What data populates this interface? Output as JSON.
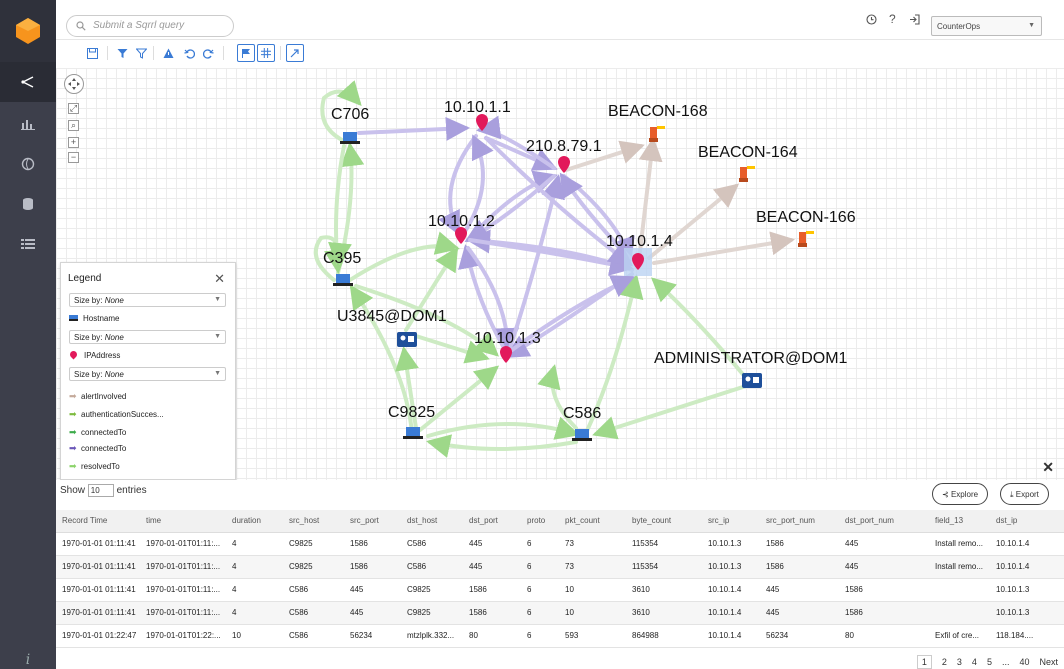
{
  "topbar": {
    "search_placeholder": "Submit a Sqrrl query",
    "help_label": "?",
    "workspace": "CounterOps"
  },
  "graph": {
    "nodes": [
      {
        "label": "C706",
        "type": "hostname"
      },
      {
        "label": "10.10.1.1",
        "type": "ip"
      },
      {
        "label": "BEACON-168",
        "type": "alert"
      },
      {
        "label": "210.8.79.1",
        "type": "ip"
      },
      {
        "label": "BEACON-164",
        "type": "alert"
      },
      {
        "label": "10.10.1.2",
        "type": "ip"
      },
      {
        "label": "BEACON-166",
        "type": "alert"
      },
      {
        "label": "10.10.1.4",
        "type": "ip"
      },
      {
        "label": "C395",
        "type": "hostname"
      },
      {
        "label": "U3845@DOM1",
        "type": "user"
      },
      {
        "label": "10.10.1.3",
        "type": "ip"
      },
      {
        "label": "ADMINISTRATOR@DOM1",
        "type": "user"
      },
      {
        "label": "C9825",
        "type": "hostname"
      },
      {
        "label": "C586",
        "type": "hostname"
      }
    ],
    "zoom_in": "+",
    "zoom_out": "−"
  },
  "legend": {
    "title": "Legend",
    "size_by_label": "Size by:",
    "size_by_value": "None",
    "node_types": [
      "Hostname",
      "IPAddress"
    ],
    "edges": [
      {
        "label": "alertInvolved",
        "color": "#c4a99a"
      },
      {
        "label": "authenticationSucces...",
        "color": "#7dbb3f"
      },
      {
        "label": "connectedTo",
        "color": "#3dab4a"
      },
      {
        "label": "connectedTo",
        "color": "#6a56b8"
      },
      {
        "label": "resolvedTo",
        "color": "#8bd36a"
      }
    ]
  },
  "table": {
    "show_label": "Show",
    "show_value": "10",
    "entries_label": "entries",
    "explore_label": "Explore",
    "export_label": "Export",
    "columns": [
      "Record Time",
      "time",
      "duration",
      "src_host",
      "src_port",
      "dst_host",
      "dst_port",
      "proto",
      "pkt_count",
      "byte_count",
      "src_ip",
      "src_port_num",
      "dst_port_num",
      "field_13",
      "dst_ip"
    ],
    "rows": [
      [
        "1970-01-01 01:11:41",
        "1970-01-01T01:11:...",
        "4",
        "C9825",
        "1586",
        "C586",
        "445",
        "6",
        "73",
        "115354",
        "10.10.1.3",
        "1586",
        "445",
        "Install remo...",
        "10.10.1.4"
      ],
      [
        "1970-01-01 01:11:41",
        "1970-01-01T01:11:...",
        "4",
        "C9825",
        "1586",
        "C586",
        "445",
        "6",
        "73",
        "115354",
        "10.10.1.3",
        "1586",
        "445",
        "Install remo...",
        "10.10.1.4"
      ],
      [
        "1970-01-01 01:11:41",
        "1970-01-01T01:11:...",
        "4",
        "C586",
        "445",
        "C9825",
        "1586",
        "6",
        "10",
        "3610",
        "10.10.1.4",
        "445",
        "1586",
        "",
        "10.10.1.3"
      ],
      [
        "1970-01-01 01:11:41",
        "1970-01-01T01:11:...",
        "4",
        "C586",
        "445",
        "C9825",
        "1586",
        "6",
        "10",
        "3610",
        "10.10.1.4",
        "445",
        "1586",
        "",
        "10.10.1.3"
      ],
      [
        "1970-01-01 01:22:47",
        "1970-01-01T01:22:...",
        "10",
        "C586",
        "56234",
        "mtzlplk.332...",
        "80",
        "6",
        "593",
        "864988",
        "10.10.1.4",
        "56234",
        "80",
        "Exfil of cre...",
        "118.184...."
      ]
    ],
    "pages": [
      "1",
      "2",
      "3",
      "4",
      "5",
      "...",
      "40",
      "Next"
    ]
  }
}
